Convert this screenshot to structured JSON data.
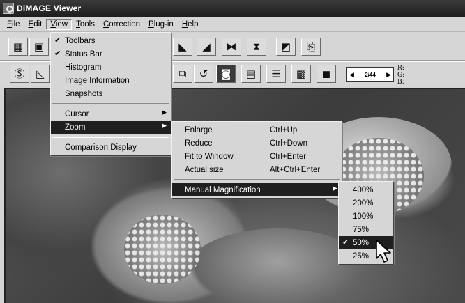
{
  "window": {
    "title": "DiMAGE Viewer"
  },
  "menubar": [
    {
      "label": "File",
      "ul": "F",
      "rest": "ile"
    },
    {
      "label": "Edit",
      "ul": "E",
      "rest": "dit"
    },
    {
      "label": "View",
      "ul": "V",
      "rest": "iew"
    },
    {
      "label": "Tools",
      "ul": "T",
      "rest": "ools"
    },
    {
      "label": "Correction",
      "ul": "C",
      "rest": "orrection"
    },
    {
      "label": "Plug-in",
      "ul": "P",
      "rest": "lug-in"
    },
    {
      "label": "Help",
      "ul": "H",
      "rest": "elp"
    }
  ],
  "toolbar": {
    "frame_counter": "2/44",
    "prev_arrow": "◀",
    "next_arrow": "▶",
    "rgb_labels": [
      "R:",
      "G:",
      "B:"
    ]
  },
  "view_menu": {
    "items": [
      {
        "label": "Toolbars",
        "checked": true
      },
      {
        "label": "Status Bar",
        "checked": true
      },
      {
        "label": "Histogram"
      },
      {
        "label": "Image Information"
      },
      {
        "label": "Snapshots"
      },
      {
        "label": "Cursor",
        "submenu": true
      },
      {
        "label": "Zoom",
        "submenu": true,
        "highlighted": true
      },
      {
        "label": "Comparison Display"
      }
    ]
  },
  "zoom_menu": {
    "items": [
      {
        "label": "Enlarge",
        "shortcut": "Ctrl+Up"
      },
      {
        "label": "Reduce",
        "shortcut": "Ctrl+Down"
      },
      {
        "label": "Fit to Window",
        "shortcut": "Ctrl+Enter"
      },
      {
        "label": "Actual size",
        "shortcut": "Alt+Ctrl+Enter"
      },
      {
        "label": "Manual Magnification",
        "submenu": true,
        "highlighted": true
      }
    ]
  },
  "magnification_menu": {
    "items": [
      {
        "label": "400%"
      },
      {
        "label": "200%"
      },
      {
        "label": "100%"
      },
      {
        "label": "75%"
      },
      {
        "label": "50%",
        "checked": true,
        "highlighted": true
      },
      {
        "label": "25%"
      }
    ]
  },
  "glyphs": {
    "check": "✔",
    "submenu_arrow": "▶"
  }
}
